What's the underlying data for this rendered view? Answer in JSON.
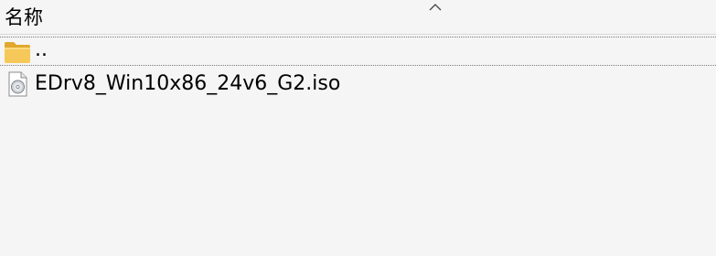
{
  "header": {
    "name_column": "名称",
    "sort_icon": "sort-ascending-chevron-icon"
  },
  "rows": [
    {
      "name": "..",
      "icon": "folder-icon",
      "selected": true
    },
    {
      "name": "EDrv8_Win10x86_24v6_G2.iso",
      "icon": "disc-image-file-icon",
      "selected": false
    }
  ],
  "colors": {
    "background": "#f5f5f5",
    "folder": "#f4c24f",
    "separator": "#d8d8d8"
  }
}
